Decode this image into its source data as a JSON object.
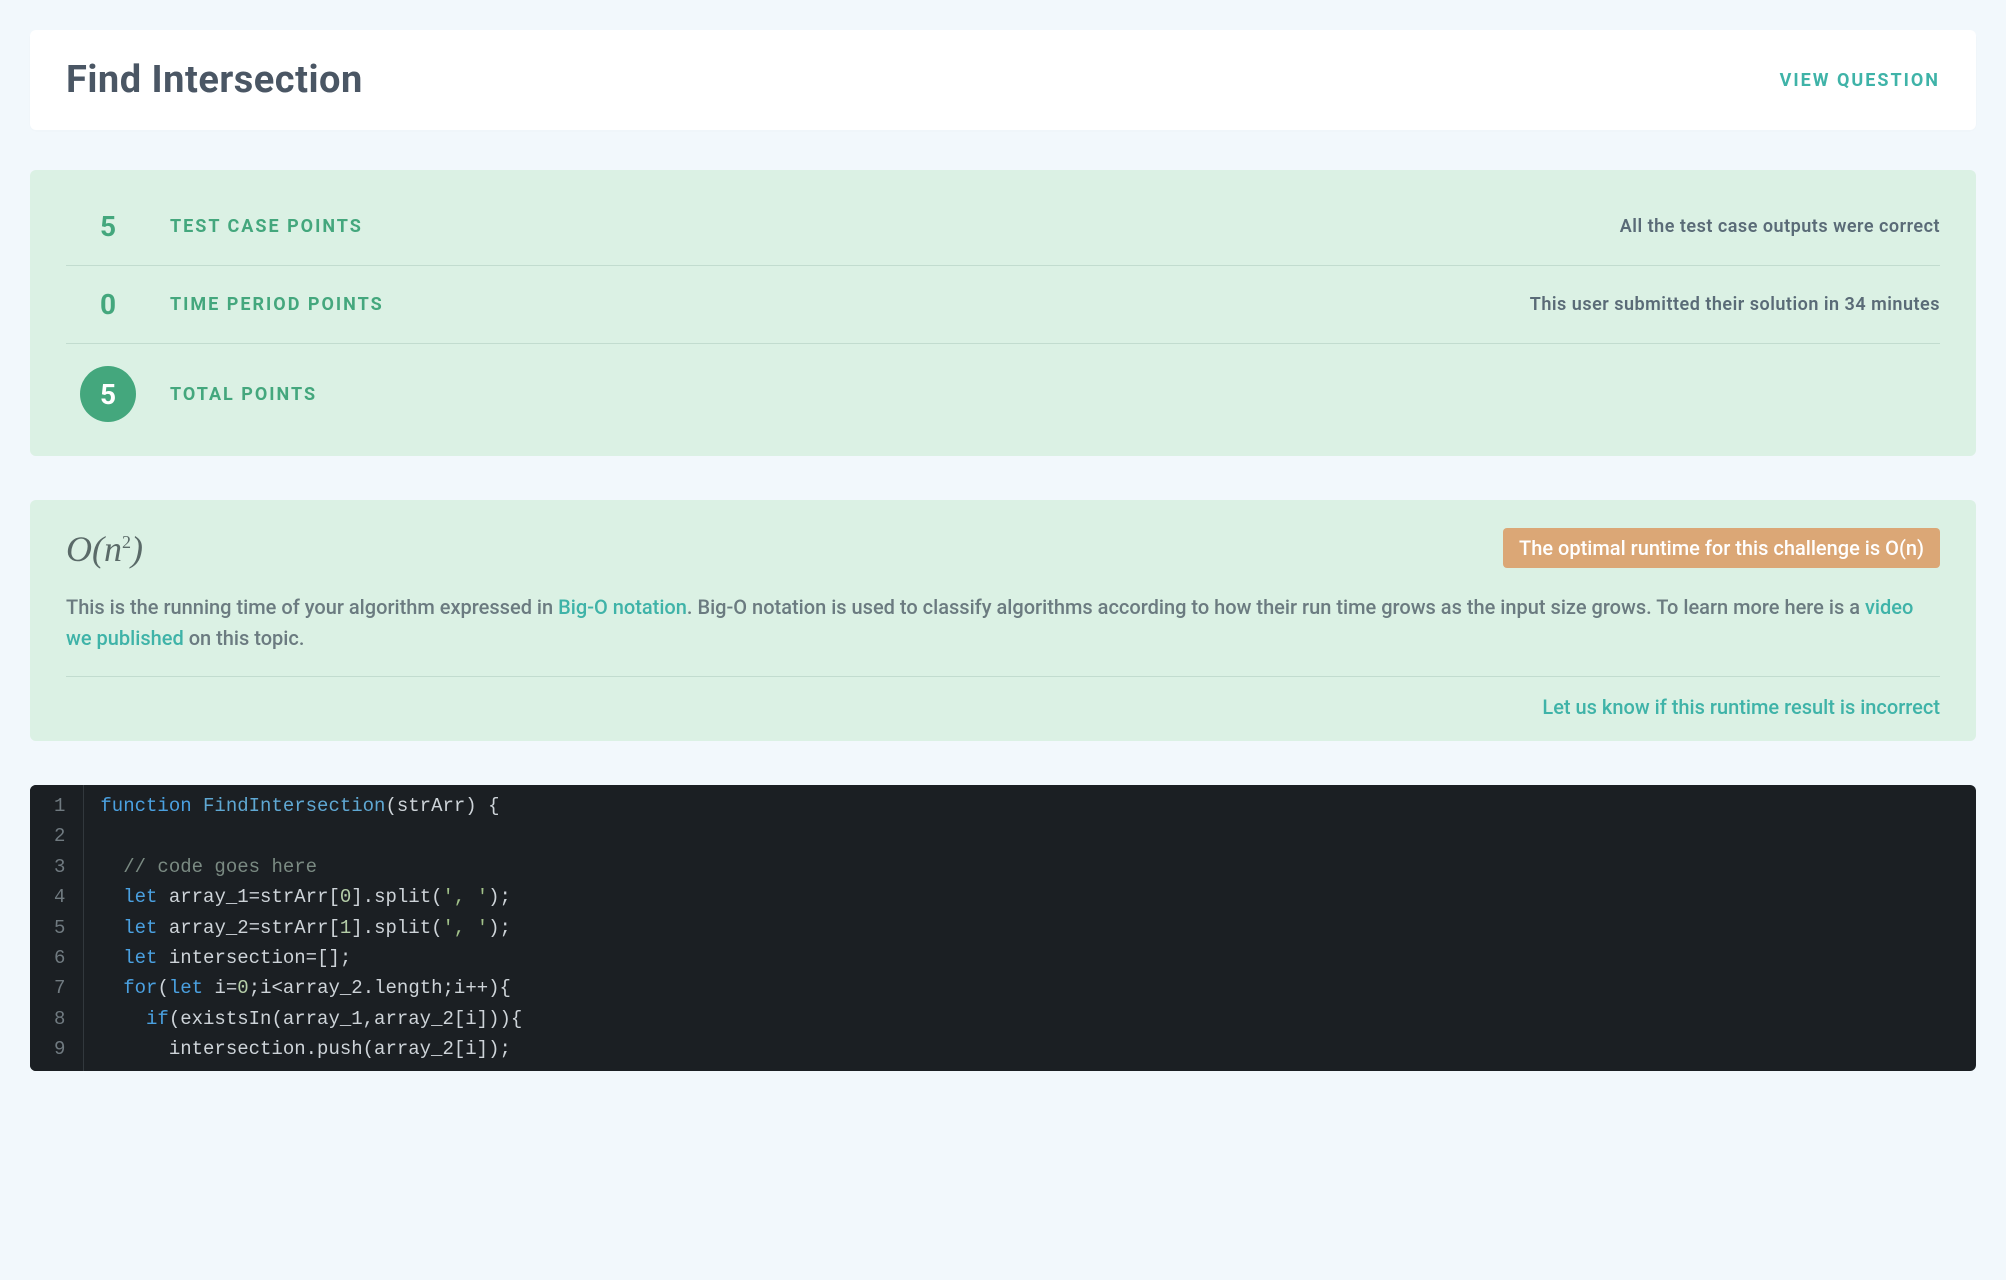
{
  "header": {
    "title": "Find Intersection",
    "view_question": "VIEW QUESTION"
  },
  "points": {
    "rows": [
      {
        "value": "5",
        "label": "TEST CASE POINTS",
        "detail": "All the test case outputs were correct"
      },
      {
        "value": "0",
        "label": "TIME PERIOD POINTS",
        "detail": "This user submitted their solution in 34 minutes"
      }
    ],
    "total": {
      "value": "5",
      "label": "TOTAL POINTS"
    }
  },
  "runtime": {
    "bigo_html": "O(<i>n</i><sup>2</sup>)",
    "optimal_text": "The optimal runtime for this challenge is O(n)",
    "desc_pre": "This is the running time of your algorithm expressed in ",
    "link_bigo": "Big-O notation",
    "desc_mid": ". Big-O notation is used to classify algorithms according to how their run time grows as the input size grows. To learn more here is a ",
    "link_video": "video we published",
    "desc_post": " on this topic.",
    "feedback": "Let us know if this runtime result is incorrect"
  },
  "code": {
    "line_numbers": [
      "1",
      "2",
      "3",
      "4",
      "5",
      "6",
      "7",
      "8",
      "9"
    ],
    "lines": [
      [
        {
          "t": "kw",
          "s": "function"
        },
        {
          "t": "",
          "s": " "
        },
        {
          "t": "fn",
          "s": "FindIntersection"
        },
        {
          "t": "",
          "s": "(strArr) {"
        }
      ],
      [
        {
          "t": "",
          "s": ""
        }
      ],
      [
        {
          "t": "",
          "s": "  "
        },
        {
          "t": "cmt",
          "s": "// code goes here"
        }
      ],
      [
        {
          "t": "",
          "s": "  "
        },
        {
          "t": "kw",
          "s": "let"
        },
        {
          "t": "",
          "s": " array_1=strArr["
        },
        {
          "t": "num",
          "s": "0"
        },
        {
          "t": "",
          "s": "].split("
        },
        {
          "t": "str",
          "s": "', '"
        },
        {
          "t": "",
          "s": ");"
        }
      ],
      [
        {
          "t": "",
          "s": "  "
        },
        {
          "t": "kw",
          "s": "let"
        },
        {
          "t": "",
          "s": " array_2=strArr["
        },
        {
          "t": "num",
          "s": "1"
        },
        {
          "t": "",
          "s": "].split("
        },
        {
          "t": "str",
          "s": "', '"
        },
        {
          "t": "",
          "s": ");"
        }
      ],
      [
        {
          "t": "",
          "s": "  "
        },
        {
          "t": "kw",
          "s": "let"
        },
        {
          "t": "",
          "s": " intersection=[];"
        }
      ],
      [
        {
          "t": "",
          "s": "  "
        },
        {
          "t": "kw",
          "s": "for"
        },
        {
          "t": "",
          "s": "("
        },
        {
          "t": "kw",
          "s": "let"
        },
        {
          "t": "",
          "s": " i="
        },
        {
          "t": "num",
          "s": "0"
        },
        {
          "t": "",
          "s": ";i<array_2.length;i++){"
        }
      ],
      [
        {
          "t": "",
          "s": "    "
        },
        {
          "t": "kw",
          "s": "if"
        },
        {
          "t": "",
          "s": "(existsIn(array_1,array_2[i])){"
        }
      ],
      [
        {
          "t": "",
          "s": "      intersection.push(array_2[i]);"
        }
      ]
    ]
  }
}
